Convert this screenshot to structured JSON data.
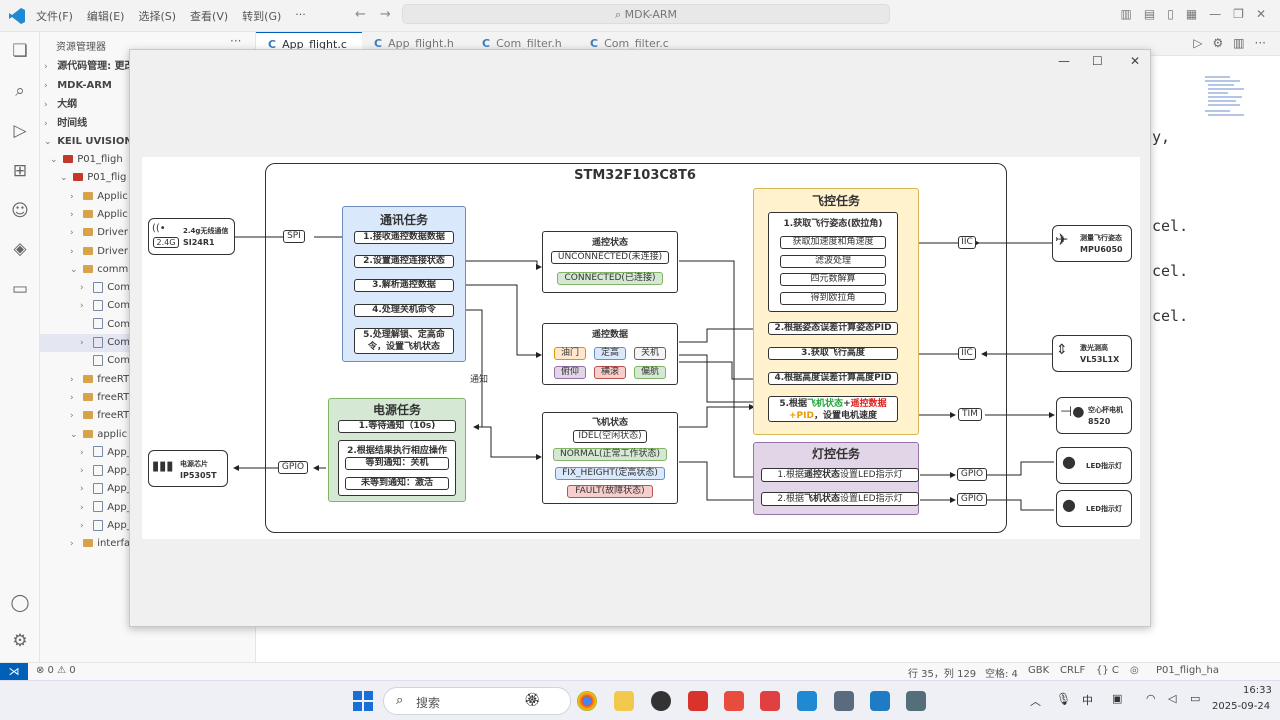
{
  "menu": [
    "文件(F)",
    "编辑(E)",
    "选择(S)",
    "查看(V)",
    "转到(G)",
    "···"
  ],
  "command_center": "MDK-ARM",
  "explorer_title": "资源管理器",
  "sidebar": {
    "sections": [
      "源代码管理: 更改",
      "MDK-ARM",
      "大纲",
      "时间线",
      "KEIL UVISION PR"
    ],
    "tree": [
      "P01_fligh",
      "P01_flig",
      "Applic",
      "Applic",
      "Driver",
      "Driver",
      "comm",
      "Com",
      "Com",
      "Com",
      "Com",
      "Com",
      "freeRT",
      "freeRT",
      "freeRT",
      "applic",
      "App_",
      "App_",
      "App_",
      "App_",
      "App_",
      "interfa"
    ]
  },
  "tabs": [
    "App_flight.c",
    "App_flight.h",
    "Com_filter.h",
    "Com_filter.c"
  ],
  "code_fragments": [
    "y,",
    "cel.",
    "cel.",
    "cel."
  ],
  "status": {
    "problems": "⊗ 0 ⚠ 0",
    "position": "行 35，列 129",
    "spaces": "空格: 4",
    "encoding": "GBK",
    "eol": "CRLF",
    "lang": "{} C",
    "project": "P01_fligh_ha",
    "time": "16:33",
    "date": "2025-09-24",
    "search": "搜索"
  },
  "diagram": {
    "chip": "STM32F103C8T6",
    "comm_task": {
      "title": "通讯任务",
      "steps": [
        "1.接收遥控数据数据",
        "2.设置遥控连接状态",
        "3.解析遥控数据",
        "4.处理关机命令",
        "5.处理解锁、定高命令，设置飞机状态"
      ]
    },
    "power_task": {
      "title": "电源任务",
      "steps": [
        "1.等待通知（10s)",
        "2.根据结果执行相应操作",
        "等到通知：关机",
        "未等到通知：激活"
      ]
    },
    "remote_state": {
      "title": "遥控状态",
      "items": [
        "UNCONNECTED(未连接)",
        "CONNECTED(已连接)"
      ]
    },
    "remote_data": {
      "title": "遥控数据",
      "items": [
        "油门",
        "定高",
        "关机",
        "俯仰",
        "横滚",
        "偏航"
      ]
    },
    "flight_state": {
      "title": "飞机状态",
      "items": [
        "IDEL(空闲状态)",
        "NORMAL(正常工作状态)",
        "FIX_HEIGHT(定高状态)",
        "FAULT(故障状态)"
      ]
    },
    "flight_task": {
      "title": "飞控任务",
      "step1": "1.获取飞行姿态(欧拉角)",
      "sub": [
        "获取加速度和角速度",
        "滤波处理",
        "四元数解算",
        "得到欧拉角"
      ],
      "step2": "2.根据姿态误差计算姿态PID",
      "step3": "3.获取飞行高度",
      "step4": "4.根据高度误差计算高度PID",
      "step5a": "5.根据",
      "step5b": "飞机状态",
      "step5c": "+",
      "step5d": "遥控数据",
      "step5e": "+PID",
      "step5f": "，设置电机速度"
    },
    "led_task": {
      "title": "灯控任务",
      "l1a": "1.根据",
      "l1b": "遥控状态",
      "l1c": "设置LED指示灯",
      "l2a": "2.根据",
      "l2b": "飞机状态",
      "l2c": "设置LED指示灯"
    },
    "interfaces": {
      "spi": "SPI",
      "iic1": "IIC",
      "iic2": "IIC",
      "tim": "TIM",
      "gpio1": "GPIO",
      "gpio2": "GPIO",
      "gpio3": "GPIO",
      "notify": "通知"
    },
    "devices": {
      "wifi_name": "2.4g无线通信",
      "wifi_chip": "SI24R1",
      "wifi_tag": "2.4G",
      "mpu_name": "测量飞行姿态",
      "mpu_chip": "MPU6050",
      "laser_name": "激光测高",
      "laser_chip": "VL53L1X",
      "motor_name": "空心杯电机",
      "motor_chip": "8520",
      "led1": "LED指示灯",
      "led2": "LED指示灯",
      "power_name": "电源芯片",
      "power_chip": "IP5305T"
    }
  },
  "colors": {
    "blue_fill": "#dae8fc",
    "blue_border": "#6c8ebf",
    "green_fill": "#d5e8d4",
    "green_border": "#82b366",
    "yellow_fill": "#fff2cc",
    "yellow_border": "#d6b656",
    "purple_fill": "#e1d5e7",
    "purple_border": "#9673a6",
    "red": "#e0201e",
    "green_text": "#22a33a"
  }
}
